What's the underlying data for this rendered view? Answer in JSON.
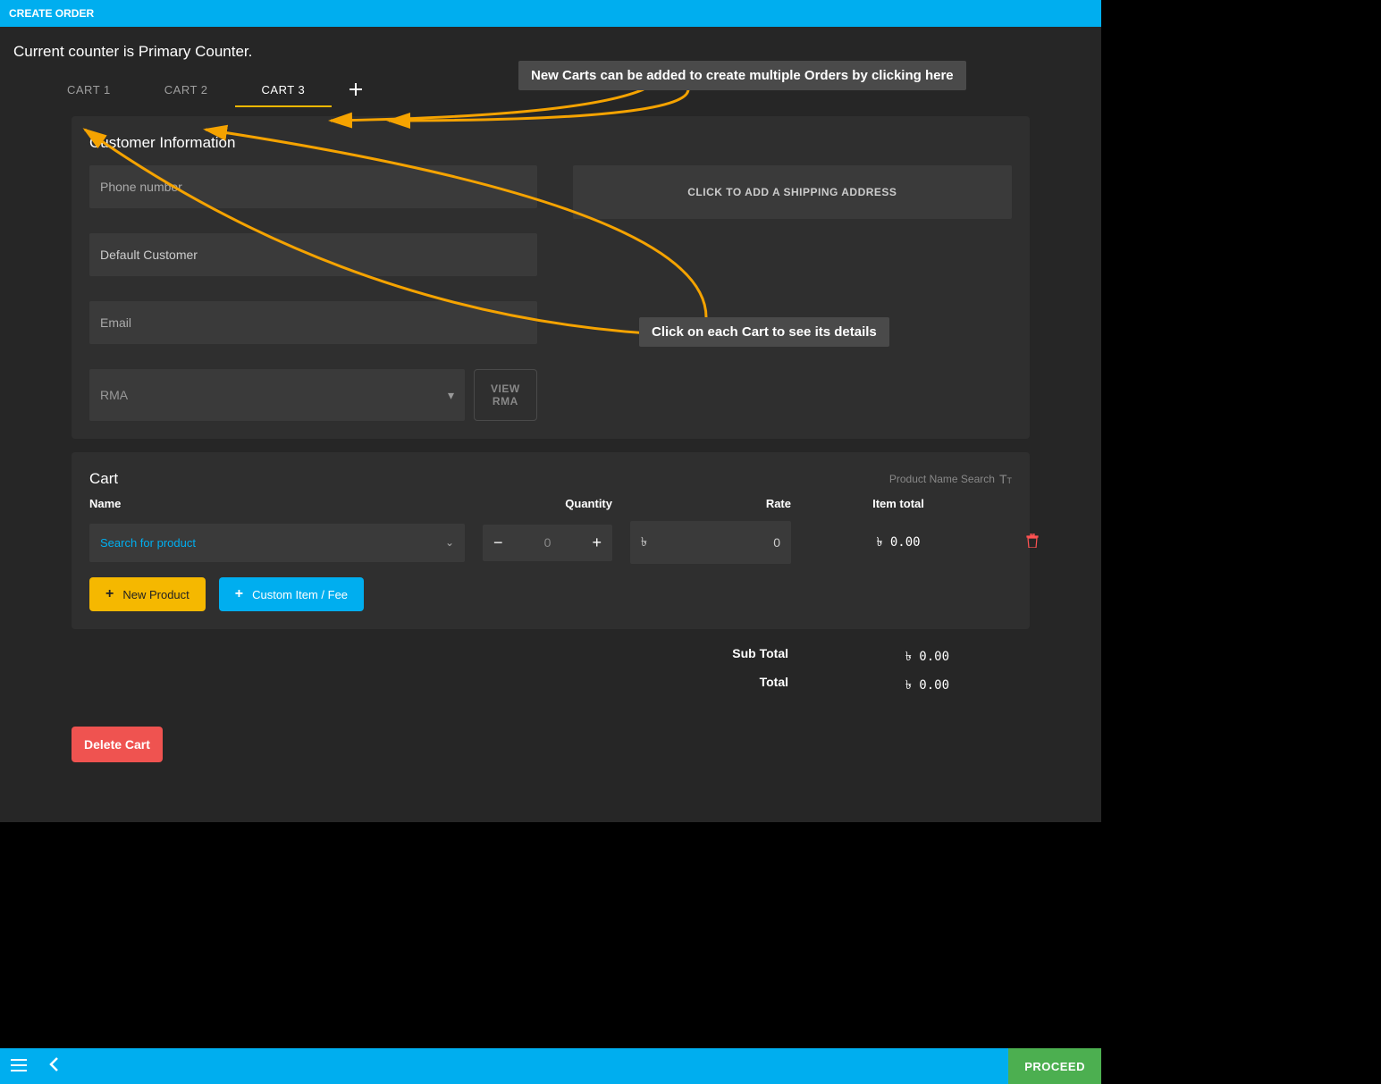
{
  "header": {
    "title": "CREATE ORDER"
  },
  "counter_text": "Current counter is Primary Counter.",
  "tabs": {
    "items": [
      "CART 1",
      "CART 2",
      "CART 3"
    ],
    "active_index": 2
  },
  "customer": {
    "section_title": "Customer Information",
    "phone_placeholder": "Phone number",
    "name_value": "Default Customer",
    "email_placeholder": "Email",
    "rma_placeholder": "RMA",
    "view_rma_label": "VIEW RMA",
    "shipping_button": "CLICK TO ADD A SHIPPING ADDRESS"
  },
  "cart": {
    "title": "Cart",
    "search_mode": "Product Name Search",
    "columns": {
      "name": "Name",
      "qty": "Quantity",
      "rate": "Rate",
      "total": "Item total"
    },
    "row": {
      "search_placeholder": "Search for product",
      "qty": "0",
      "rate_currency": "৳",
      "rate_value": "0",
      "item_total": "৳ 0.00"
    },
    "new_product_label": "New Product",
    "custom_item_label": "Custom Item / Fee"
  },
  "totals": {
    "subtotal_label": "Sub Total",
    "subtotal_value": "৳ 0.00",
    "total_label": "Total",
    "total_value": "৳ 0.00"
  },
  "delete_cart_label": "Delete Cart",
  "footer": {
    "proceed": "PROCEED"
  },
  "annotations": {
    "add_cart_tip": "New Carts can be added to create multiple Orders by clicking here",
    "click_cart_tip": "Click on each Cart to see its details"
  }
}
